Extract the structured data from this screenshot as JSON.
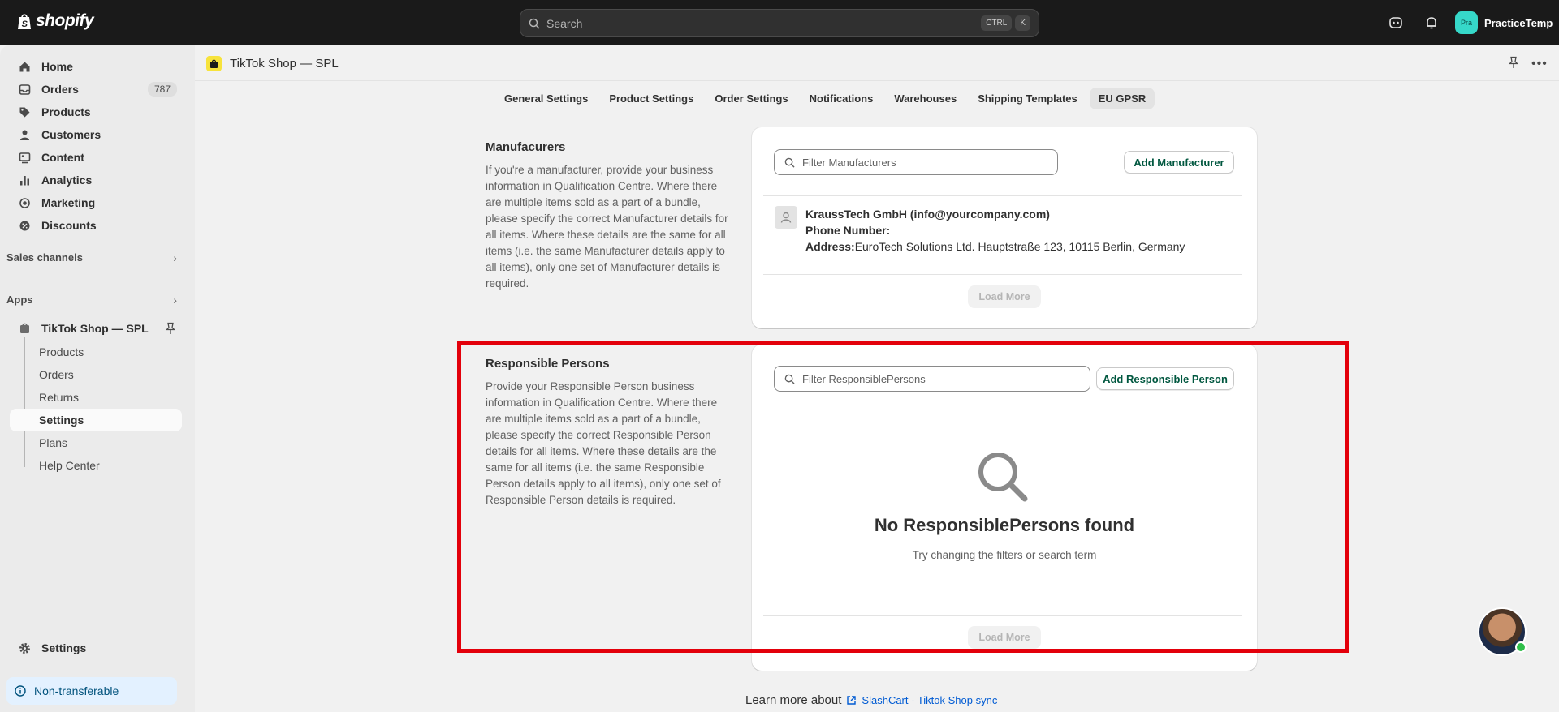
{
  "topbar": {
    "brand": "shopify",
    "search_placeholder": "Search",
    "shortcut_keys": [
      "CTRL",
      "K"
    ],
    "user_initials": "Pra",
    "user_name": "PracticeTemp"
  },
  "sidebar": {
    "items": [
      {
        "label": "Home",
        "icon": "home-icon"
      },
      {
        "label": "Orders",
        "icon": "orders-icon",
        "badge": "787"
      },
      {
        "label": "Products",
        "icon": "tag-icon"
      },
      {
        "label": "Customers",
        "icon": "person-icon"
      },
      {
        "label": "Content",
        "icon": "content-icon"
      },
      {
        "label": "Analytics",
        "icon": "bar-chart-icon"
      },
      {
        "label": "Marketing",
        "icon": "target-icon"
      },
      {
        "label": "Discounts",
        "icon": "discount-icon"
      }
    ],
    "sales_channels": "Sales channels",
    "apps": "Apps",
    "app_name": "TikTok Shop — SPL",
    "app_subitems": [
      "Products",
      "Orders",
      "Returns",
      "Settings",
      "Plans",
      "Help Center"
    ],
    "active_subitem": "Settings",
    "settings": "Settings",
    "non_transferable": "Non-transferable"
  },
  "header": {
    "app_title": "TikTok Shop — SPL"
  },
  "tabs": [
    {
      "label": "General Settings",
      "active": false
    },
    {
      "label": "Product Settings",
      "active": false
    },
    {
      "label": "Order Settings",
      "active": false
    },
    {
      "label": "Notifications",
      "active": false
    },
    {
      "label": "Warehouses",
      "active": false
    },
    {
      "label": "Shipping Templates",
      "active": false
    },
    {
      "label": "EU GPSR",
      "active": true
    }
  ],
  "manufacturers": {
    "title": "Manufacurers",
    "description": "If you're a manufacturer, provide your business information in Qualification Centre. Where there are multiple items sold as a part of a bundle, please specify the correct Manufacturer details for all items. Where these details are the same for all items (i.e. the same Manufacturer details apply to all items), only one set of Manufacturer details is required.",
    "filter_placeholder": "Filter Manufacturers",
    "add_button": "Add Manufacturer",
    "entry": {
      "name": "KraussTech GmbH (info@yourcompany.com)",
      "phone_label": "Phone Number:",
      "phone_value": "",
      "address_label": "Address:",
      "address_value": "EuroTech Solutions Ltd. Hauptstraße 123, 10115 Berlin, Germany"
    },
    "load_more": "Load More"
  },
  "responsible_persons": {
    "title": "Responsible Persons",
    "description": "Provide your Responsible Person business information in Qualification Centre. Where there are multiple items sold as a part of a bundle, please specify the correct Responsible Person details for all items. Where these details are the same for all items (i.e. the same Responsible Person details apply to all items), only one set of Responsible Person details is required.",
    "filter_placeholder": "Filter ResponsiblePersons",
    "add_button": "Add Responsible Person",
    "empty_title": "No ResponsiblePersons found",
    "empty_subtitle": "Try changing the filters or search term",
    "load_more": "Load More"
  },
  "footer": {
    "learn_more": "Learn more about",
    "link_text": "SlashCart - Tiktok Shop sync"
  },
  "colors": {
    "topbar_bg": "#1a1a1a",
    "highlight_border": "#e3000b",
    "accent_green": "#00573f",
    "link_blue": "#005bd3"
  }
}
